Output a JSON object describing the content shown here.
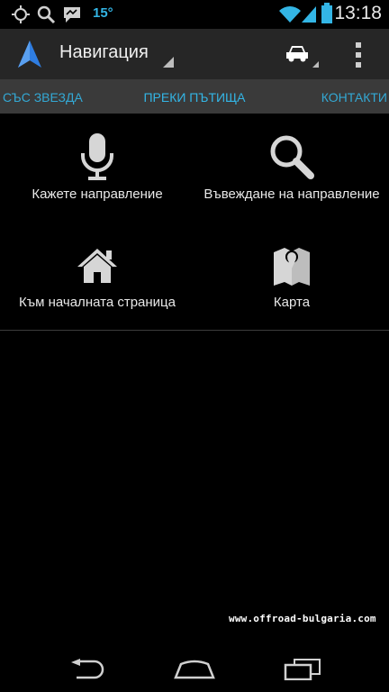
{
  "status_bar": {
    "icons": [
      "gps-icon",
      "search-icon",
      "talk-icon",
      "wifi-icon",
      "signal-icon",
      "battery-icon"
    ],
    "temperature": "15°",
    "time": "13:18"
  },
  "action_bar": {
    "title": "Навигация",
    "icons": [
      "navigation-arrow-icon",
      "car-icon",
      "overflow-menu-icon"
    ]
  },
  "tabs": [
    {
      "label": "СЪС ЗВЕЗДА"
    },
    {
      "label": "ПРЕКИ ПЪТИЩА"
    },
    {
      "label": "КОНТАКТИ"
    }
  ],
  "shortcuts": [
    {
      "label": "Кажете направление",
      "icon": "microphone-icon"
    },
    {
      "label": "Въвеждане на направление",
      "icon": "search-icon"
    },
    {
      "label": "Към началната страница",
      "icon": "home-icon"
    },
    {
      "label": "Карта",
      "icon": "map-icon"
    }
  ],
  "watermark": "www.offroad-bulgaria.com",
  "nav_bar": {
    "icons": [
      "back-icon",
      "home-icon",
      "recent-apps-icon"
    ]
  },
  "colors": {
    "accent": "#33b5e5",
    "action_bar": "#262626",
    "tab_strip": "#3a3a3a",
    "background": "#000000"
  }
}
